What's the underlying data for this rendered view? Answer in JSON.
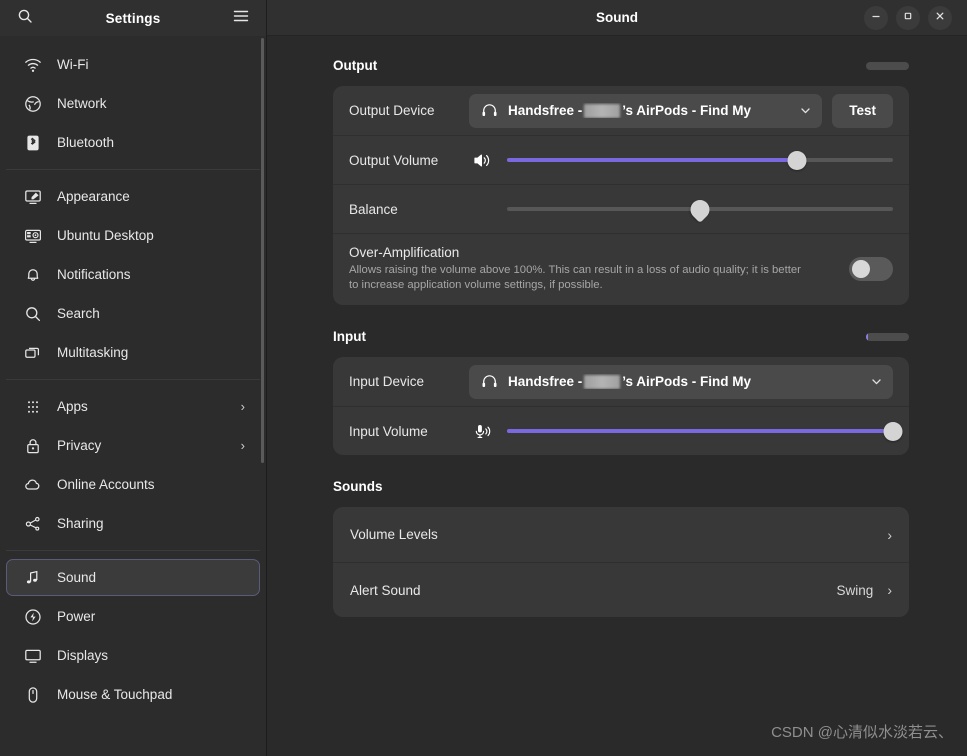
{
  "sidebar": {
    "title": "Settings",
    "search_icon": "search-icon",
    "menu_icon": "hamburger-menu-icon",
    "groups": [
      {
        "items": [
          {
            "label": "Wi-Fi",
            "icon": "wifi-icon",
            "chevron": "",
            "selected": false
          },
          {
            "label": "Network",
            "icon": "network-icon",
            "chevron": "",
            "selected": false
          },
          {
            "label": "Bluetooth",
            "icon": "bluetooth-icon",
            "chevron": "",
            "selected": false
          }
        ]
      },
      {
        "items": [
          {
            "label": "Appearance",
            "icon": "appearance-icon",
            "chevron": "",
            "selected": false
          },
          {
            "label": "Ubuntu Desktop",
            "icon": "ubuntu-desktop-icon",
            "chevron": "",
            "selected": false
          },
          {
            "label": "Notifications",
            "icon": "bell-icon",
            "chevron": "",
            "selected": false
          },
          {
            "label": "Search",
            "icon": "search-icon",
            "chevron": "",
            "selected": false
          },
          {
            "label": "Multitasking",
            "icon": "multitasking-icon",
            "chevron": "",
            "selected": false
          }
        ]
      },
      {
        "items": [
          {
            "label": "Apps",
            "icon": "apps-grid-icon",
            "chevron": "›",
            "selected": false
          },
          {
            "label": "Privacy",
            "icon": "lock-icon",
            "chevron": "›",
            "selected": false
          },
          {
            "label": "Online Accounts",
            "icon": "cloud-icon",
            "chevron": "",
            "selected": false
          },
          {
            "label": "Sharing",
            "icon": "share-icon",
            "chevron": "",
            "selected": false
          }
        ]
      },
      {
        "items": [
          {
            "label": "Sound",
            "icon": "music-note-icon",
            "chevron": "",
            "selected": true
          },
          {
            "label": "Power",
            "icon": "power-icon",
            "chevron": "",
            "selected": false
          },
          {
            "label": "Displays",
            "icon": "display-icon",
            "chevron": "",
            "selected": false
          },
          {
            "label": "Mouse & Touchpad",
            "icon": "mouse-icon",
            "chevron": "",
            "selected": false
          }
        ]
      }
    ]
  },
  "window": {
    "title": "Sound",
    "minimize_icon": "minimize-icon",
    "maximize_icon": "maximize-icon",
    "close_icon": "close-icon"
  },
  "output": {
    "section_title": "Output",
    "device_label": "Output Device",
    "device_icon": "headphones-icon",
    "device_prefix": "Handsfree - ",
    "device_suffix": "’s AirPods - Find My",
    "device_redacted": true,
    "dropdown_icon": "chevron-down-icon",
    "test_label": "Test",
    "volume_label": "Output Volume",
    "volume_icon": "speaker-icon",
    "volume_percent": 75,
    "balance_label": "Balance",
    "balance_percent": 50,
    "over_amplification_title": "Over-Amplification",
    "over_amplification_desc": "Allows raising the volume above 100%. This can result in a loss of audio quality; it is better to increase application volume settings, if possible.",
    "over_amplification_on": false,
    "level_meter_percent": 0
  },
  "input": {
    "section_title": "Input",
    "device_label": "Input Device",
    "device_icon": "headphones-icon",
    "device_prefix": "Handsfree - ",
    "device_suffix": "’s AirPods - Find My",
    "dropdown_icon": "chevron-down-icon",
    "volume_label": "Input Volume",
    "volume_icon": "microphone-icon",
    "volume_percent": 100,
    "level_meter_percent": 5
  },
  "sounds": {
    "section_title": "Sounds",
    "rows": [
      {
        "label": "Volume Levels",
        "value": "",
        "chevron": "›"
      },
      {
        "label": "Alert Sound",
        "value": "Swing",
        "chevron": "›"
      }
    ]
  },
  "watermark": "CSDN @心清似水淡若云、",
  "colors": {
    "accent": "#7a68e0",
    "background": "#2a2a2a",
    "card": "#383838",
    "sidebar": "#2c2c2c",
    "header": "#303030"
  }
}
